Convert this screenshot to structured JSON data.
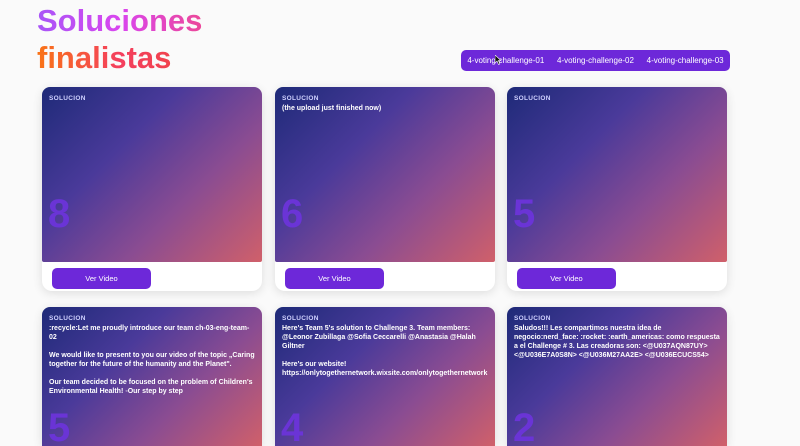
{
  "header": {
    "title_line1": "Soluciones",
    "title_line2": "finalistas"
  },
  "tabs": [
    {
      "label": "4-voting-challenge-01"
    },
    {
      "label": "4-voting-challenge-02"
    },
    {
      "label": "4-voting-challenge-03"
    }
  ],
  "colors": {
    "accent": "#6d28d9",
    "tile_gradient": [
      "#1e2a78",
      "#4a3a9a",
      "#8a4c92",
      "#d0606a"
    ]
  },
  "cards": [
    {
      "label": "SOLUCION",
      "description": "",
      "number": "8",
      "button": "Ver Video"
    },
    {
      "label": "SOLUCION",
      "description": "(the upload just finished now)",
      "number": "6",
      "button": "Ver Video"
    },
    {
      "label": "SOLUCION",
      "description": "",
      "number": "5",
      "button": "Ver Video"
    },
    {
      "label": "SOLUCION",
      "description": ":recycle:Let me proudly introduce our team ch-03-eng-team-02\n\nWe would like to present to you our video of the topic „Caring together for the future of the humanity and the Planet\".\n\nOur team decided to be focused on the problem of Children's Environmental Health! ◦Our step by step",
      "number": "5",
      "button": "Ver Video"
    },
    {
      "label": "SOLUCION",
      "description": "Here's Team 5's solution to Challenge 3. Team members: @Leonor Zubillaga @Sofia Ceccarelli @Anastasia @Halah Giltner\n\nHere's our website!\nhttps://onlytogethernetwork.wixsite.com/onlytogethernetwork",
      "number": "4",
      "button": "Ver Video"
    },
    {
      "label": "SOLUCION",
      "description": "Saludos!!! Les compartimos nuestra idea de negocio:nerd_face: :rocket: :earth_americas: como respuesta a el Challenge # 3. Las creadoras son: <@U037AQN87UY> <@U036E7A0S8N> <@U036M27AA2E> <@U036ECUCS54>",
      "number": "2",
      "button": "Ver Video"
    }
  ]
}
